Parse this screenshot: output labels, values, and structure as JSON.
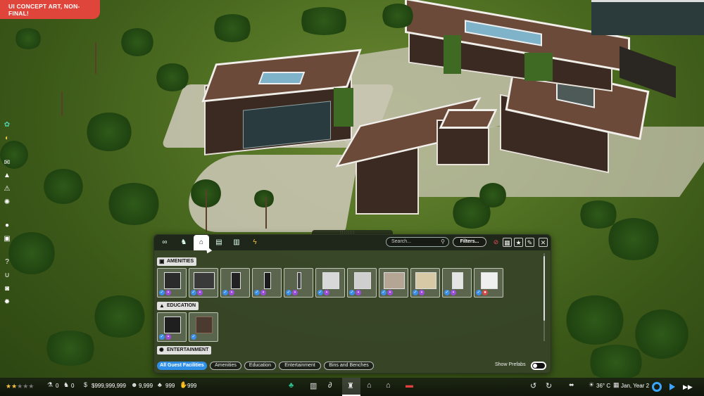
{
  "banner": {
    "text": "UI CONCEPT ART, NON-FINAL!"
  },
  "left_toolbar": {
    "icons": [
      "dna-icon",
      "cycle-icon",
      "mail-icon",
      "bell-icon",
      "warning-icon",
      "gear-icon",
      "mouse-icon",
      "document-icon",
      "help-icon",
      "magnet-icon",
      "camera-icon",
      "settings-icon"
    ]
  },
  "panel": {
    "grip": "::::::::",
    "tabs": [
      "infinity-icon",
      "dinosaur-icon",
      "shop-icon",
      "building-icon",
      "building-alt-icon",
      "power-icon"
    ],
    "active_tab": 2,
    "search": {
      "placeholder": "Search..."
    },
    "filters_label": "Filters...",
    "toolbar_icons": [
      "no-icon",
      "grid-icon",
      "star-icon",
      "pin-icon",
      "close-icon"
    ],
    "sections": [
      {
        "title": "AMENITIES",
        "icon": "shop-icon",
        "item_count": 11,
        "badges": [
          "purple",
          "purple",
          "purple",
          "purple",
          "purple",
          "purple",
          "purple",
          "purple",
          "purple",
          "purple",
          "red"
        ]
      },
      {
        "title": "EDUCATION",
        "icon": "graduation-cap-icon",
        "item_count": 2,
        "badges": [
          "purple",
          "none"
        ]
      },
      {
        "title": "ENTERTAINMENT",
        "icon": "ferris-wheel-icon",
        "item_count": 0
      }
    ],
    "bottom_tabs": [
      "All Guest Facilities",
      "Amenities",
      "Education",
      "Entertainment",
      "Bins and Benches"
    ],
    "active_bottom_tab": 0,
    "show_prefabs_label": "Show Prefabs",
    "show_prefabs_on": false
  },
  "status": {
    "rating_stars": 2,
    "rating_max": 5,
    "staff": "0",
    "dinos": "0",
    "money": "$999,999,999",
    "guests": "9,999",
    "stat3": "999",
    "stat4": "999",
    "temperature": "36° C",
    "date": "Jan, Year 2"
  },
  "bottom_tools": [
    "tree-icon",
    "wall-icon",
    "dinosaur-icon",
    "build-icon",
    "facility-icon",
    "park-icon",
    "barn-icon",
    "research-icon"
  ]
}
